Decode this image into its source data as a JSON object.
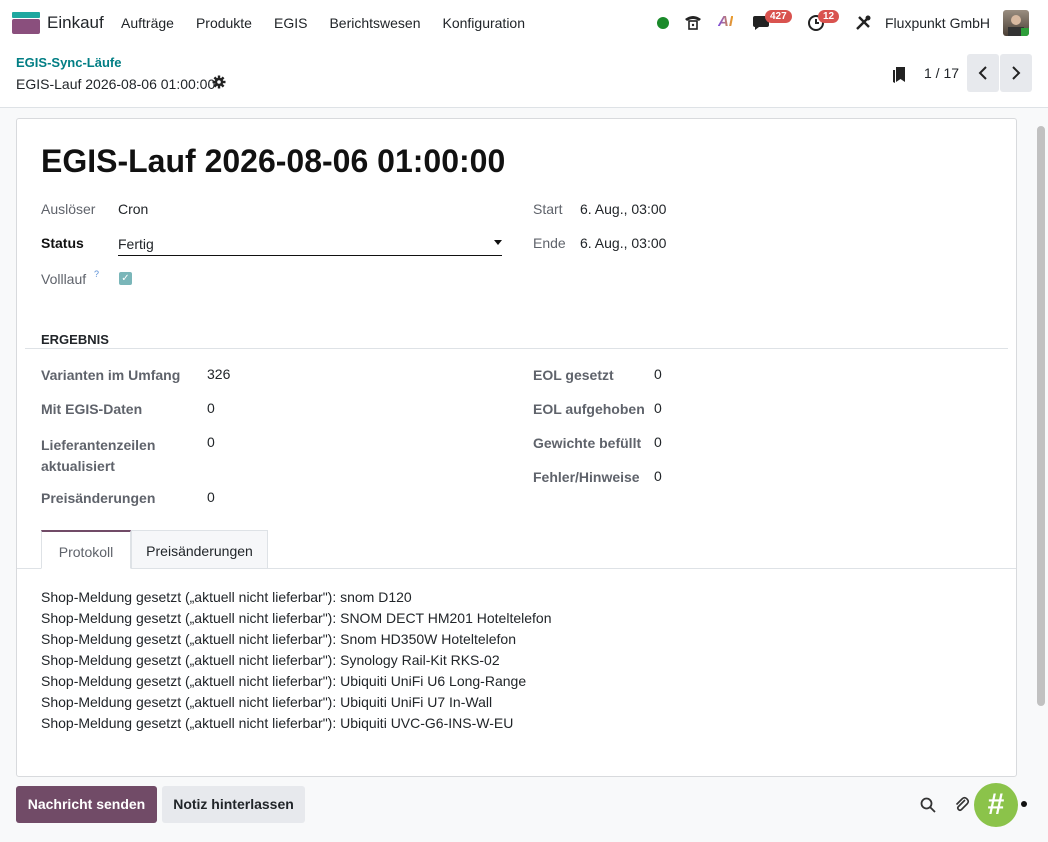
{
  "nav": {
    "app_name": "Einkauf",
    "menu": [
      "Aufträge",
      "Produkte",
      "EGIS",
      "Berichtswesen",
      "Konfiguration"
    ],
    "messages_count": "427",
    "activities_count": "12",
    "company": "Fluxpunkt GmbH",
    "ai_label": "AI"
  },
  "breadcrumb": {
    "parent": "EGIS-Sync-Läufe",
    "current": "EGIS-Lauf 2026-08-06 01:00:00"
  },
  "pager": {
    "value": "1 / 17"
  },
  "form": {
    "title": "EGIS-Lauf 2026-08-06 01:00:00",
    "fields": {
      "ausloeser_label": "Auslöser",
      "ausloeser_value": "Cron",
      "status_label": "Status",
      "status_value": "Fertig",
      "vollauf_label": "Volllauf",
      "vollauf_help": "?",
      "vollauf_checked": true,
      "start_label": "Start",
      "start_value": "6. Aug., 03:00",
      "ende_label": "Ende",
      "ende_value": "6. Aug., 03:00"
    },
    "result_section": "ERGEBNIS",
    "results_left": [
      {
        "label": "Varianten im Umfang",
        "value": "326"
      },
      {
        "label": "Mit EGIS-Daten",
        "value": "0"
      },
      {
        "label": "Lieferantenzeilen aktualisiert",
        "value": "0"
      },
      {
        "label": "Preisänderungen",
        "value": "0"
      }
    ],
    "results_right": [
      {
        "label": "EOL gesetzt",
        "value": "0"
      },
      {
        "label": "EOL aufgehoben",
        "value": "0"
      },
      {
        "label": "Gewichte befüllt",
        "value": "0"
      },
      {
        "label": "Fehler/Hinweise",
        "value": "0"
      }
    ],
    "tabs": [
      "Protokoll",
      "Preisänderungen"
    ],
    "log": [
      "Shop-Meldung gesetzt („aktuell nicht lieferbar\"): snom D120",
      "Shop-Meldung gesetzt („aktuell nicht lieferbar\"): SNOM DECT HM201 Hoteltelefon",
      "Shop-Meldung gesetzt („aktuell nicht lieferbar\"): Snom HD350W Hoteltelefon",
      "Shop-Meldung gesetzt („aktuell nicht lieferbar\"): Synology Rail-Kit RKS-02",
      "Shop-Meldung gesetzt („aktuell nicht lieferbar\"): Ubiquiti UniFi U6 Long-Range",
      "Shop-Meldung gesetzt („aktuell nicht lieferbar\"): Ubiquiti UniFi U7 In-Wall",
      "Shop-Meldung gesetzt („aktuell nicht lieferbar\"): Ubiquiti UVC-G6-INS-W-EU"
    ]
  },
  "chatter": {
    "send_message": "Nachricht senden",
    "log_note": "Notiz hinterlassen",
    "fab_label": "#"
  },
  "colors": {
    "primary": "#714b67",
    "link": "#017e84",
    "badge": "#d9534f",
    "online": "#1a8a2a",
    "fab": "#8bc34a"
  }
}
